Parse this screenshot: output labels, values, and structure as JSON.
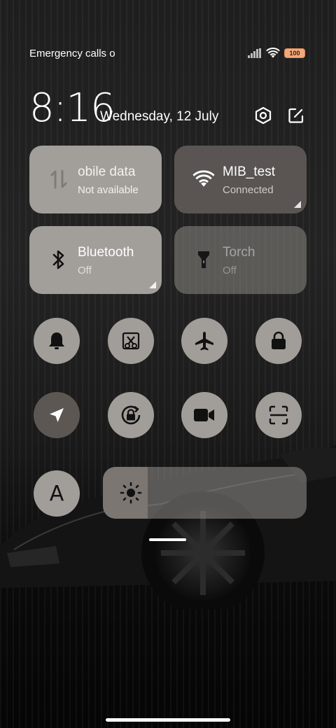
{
  "status_bar": {
    "carrier_text": "Emergency calls o",
    "battery": "100",
    "signal_icon": "signal-icon",
    "wifi_icon": "wifi-icon"
  },
  "header": {
    "time": "8:16",
    "date": "Wednesday, 12 July",
    "settings_icon": "settings-icon",
    "edit_icon": "edit-icon"
  },
  "tiles": {
    "mobile_data": {
      "title": "obile data",
      "subtitle": "Not available"
    },
    "wifi": {
      "title": "MIB_test",
      "subtitle": "Connected"
    },
    "bluetooth": {
      "title": "Bluetooth",
      "subtitle": "Off"
    },
    "torch": {
      "title": "Torch",
      "subtitle": "Off"
    }
  },
  "toggles": [
    {
      "icon": "bell-icon",
      "active": false
    },
    {
      "icon": "screenshot-icon",
      "active": false
    },
    {
      "icon": "airplane-icon",
      "active": false
    },
    {
      "icon": "lock-icon",
      "active": false
    },
    {
      "icon": "location-icon",
      "active": true
    },
    {
      "icon": "rotation-lock-icon",
      "active": false
    },
    {
      "icon": "video-camera-icon",
      "active": false
    },
    {
      "icon": "scanner-icon",
      "active": false
    },
    {
      "icon": "font-icon",
      "active": false,
      "label": "A"
    }
  ],
  "brightness": {
    "level": 0.22,
    "icon": "sun-icon"
  },
  "colors": {
    "tile_light": "#a29e9a",
    "tile_dark": "#5a5552",
    "toggle_active": "#5c5753",
    "battery": "#f3a87a"
  }
}
